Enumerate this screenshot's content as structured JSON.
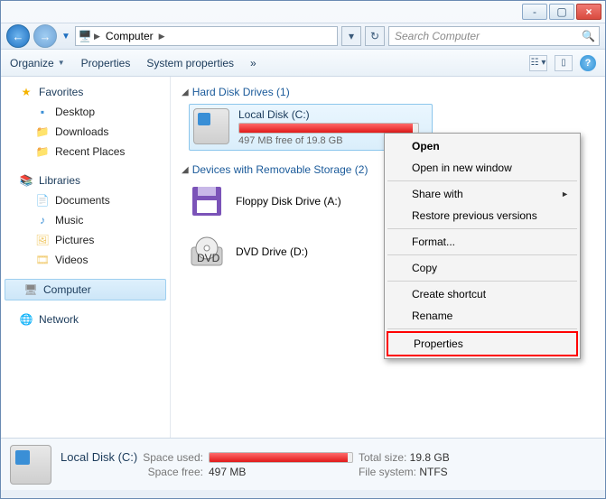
{
  "titlebar": {
    "min": "-",
    "max": "▢",
    "close": "×"
  },
  "nav": {
    "crumb_label": "Computer",
    "refresh": "↻"
  },
  "search": {
    "placeholder": "Search Computer",
    "icon": "🔍"
  },
  "toolbar": {
    "organize": "Organize",
    "properties": "Properties",
    "system_properties": "System properties",
    "overflow": "»"
  },
  "sidebar": {
    "favorites": {
      "label": "Favorites",
      "items": [
        "Desktop",
        "Downloads",
        "Recent Places"
      ]
    },
    "libraries": {
      "label": "Libraries",
      "items": [
        "Documents",
        "Music",
        "Pictures",
        "Videos"
      ]
    },
    "computer": {
      "label": "Computer"
    },
    "network": {
      "label": "Network"
    }
  },
  "main": {
    "hdd_header": "Hard Disk Drives (1)",
    "removable_header": "Devices with Removable Storage (2)",
    "drive": {
      "name": "Local Disk (C:)",
      "free_text": "497 MB free of 19.8 GB",
      "fill_pct": 97
    },
    "floppy": "Floppy Disk Drive (A:)",
    "dvd": "DVD Drive (D:)"
  },
  "context": {
    "open": "Open",
    "open_new": "Open in new window",
    "share": "Share with",
    "restore": "Restore previous versions",
    "format": "Format...",
    "copy": "Copy",
    "shortcut": "Create shortcut",
    "rename": "Rename",
    "properties": "Properties"
  },
  "details": {
    "title": "Local Disk (C:)",
    "space_used_lbl": "Space used:",
    "space_free_lbl": "Space free:",
    "space_free_val": "497 MB",
    "total_lbl": "Total size:",
    "total_val": "19.8 GB",
    "fs_lbl": "File system:",
    "fs_val": "NTFS",
    "fill_pct": 97
  }
}
